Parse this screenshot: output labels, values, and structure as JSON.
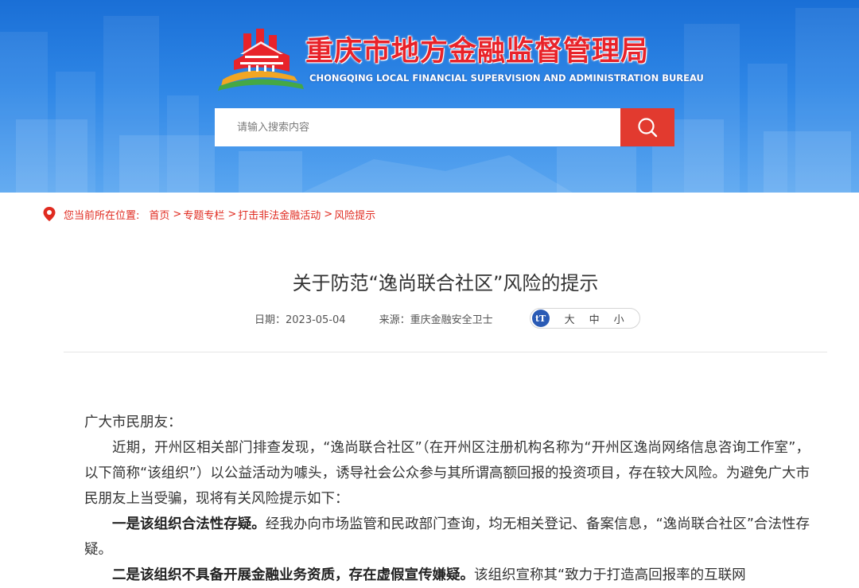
{
  "header": {
    "site_title": "重庆市地方金融监督管理局",
    "site_subtitle": "CHONGQING LOCAL FINANCIAL SUPERVISION AND ADMINISTRATION BUREAU",
    "logo_icon": "bureau-emblem-icon",
    "search_placeholder": "请输入搜索内容",
    "search_icon": "search-icon",
    "accent_red": "#e23a2f",
    "banner_blue": "#1a6fd6"
  },
  "breadcrumb": {
    "label": "您当前所在位置:",
    "items": [
      "首页",
      "专题专栏",
      "打击非法金融活动",
      "风险提示"
    ],
    "separator": ">"
  },
  "article": {
    "title": "关于防范“逸尚联合社区”风险的提示",
    "date": "日期：2023-05-04",
    "source": "来源：重庆金融安全卫士",
    "font_size_options": [
      "大",
      "中",
      "小"
    ],
    "font_size_icon": "font-size-icon",
    "greeting": "广大市民朋友：",
    "paragraph1": "近期，开州区相关部门排查发现，“逸尚联合社区”（在开州区注册机构名称为“开州区逸尚网络信息咨询工作室”，以下简称“该组织”）以公益活动为噱头，诱导社会公众参与其所谓高额回报的投资项目，存在较大风险。为避免广大市民朋友上当受骗，现将有关风险提示如下：",
    "point1_bold": "一是该组织合法性存疑。",
    "point1_text": "经我办向市场监管和民政部门查询，均无相关登记、备案信息，“逸尚联合社区”合法性存疑。",
    "point2_bold": "二是该组织不具备开展金融业务资质，存在虚假宣传嫌疑。",
    "point2_text": "该组织宣称其“致力于打造高回报率的互联网"
  }
}
